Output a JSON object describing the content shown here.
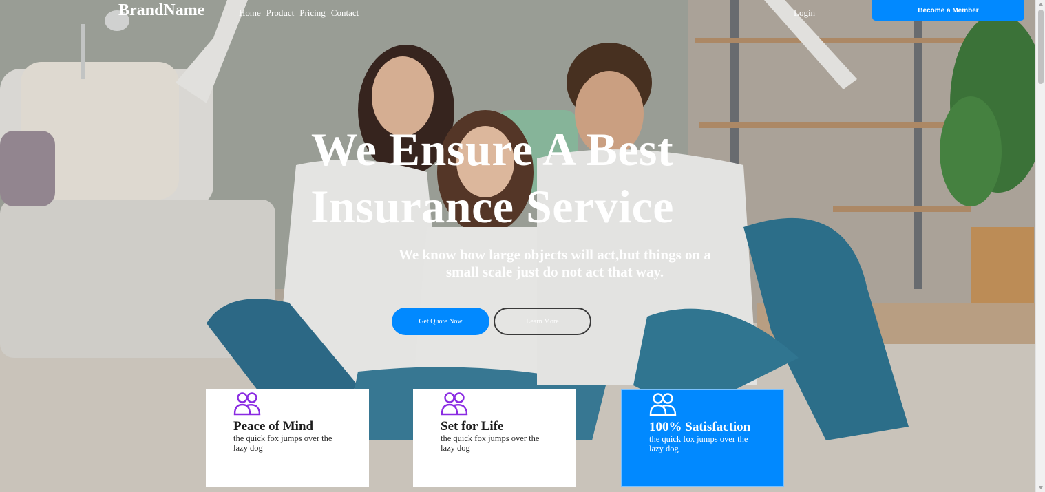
{
  "navbar": {
    "brand": "BrandName",
    "links": [
      "Home",
      "Product",
      "Pricing",
      "Contact"
    ],
    "login": "Login",
    "cta": "Become a Member"
  },
  "hero": {
    "title_line1": "We Ensure A Best",
    "title_line2": "Insurance Service",
    "subtitle_line1": "We know how large objects will act,but things on a",
    "subtitle_line2": "small scale just do not act that way.",
    "primary_button": "Get Quote Now",
    "secondary_button": "Learn More"
  },
  "features": [
    {
      "title": "Peace of Mind",
      "text": "the quick fox jumps over the lazy dog",
      "icon": "users-icon",
      "highlight": false
    },
    {
      "title": "Set for Life",
      "text": "the quick fox jumps over the lazy dog",
      "icon": "users-icon",
      "highlight": false
    },
    {
      "title": "100% Satisfaction",
      "text": "the quick fox jumps over the lazy dog",
      "icon": "users-icon",
      "highlight": true
    }
  ],
  "colors": {
    "primary": "#0189ff",
    "icon_purple": "#8a2be2",
    "text_dark": "#1c1c1c",
    "white": "#ffffff"
  }
}
